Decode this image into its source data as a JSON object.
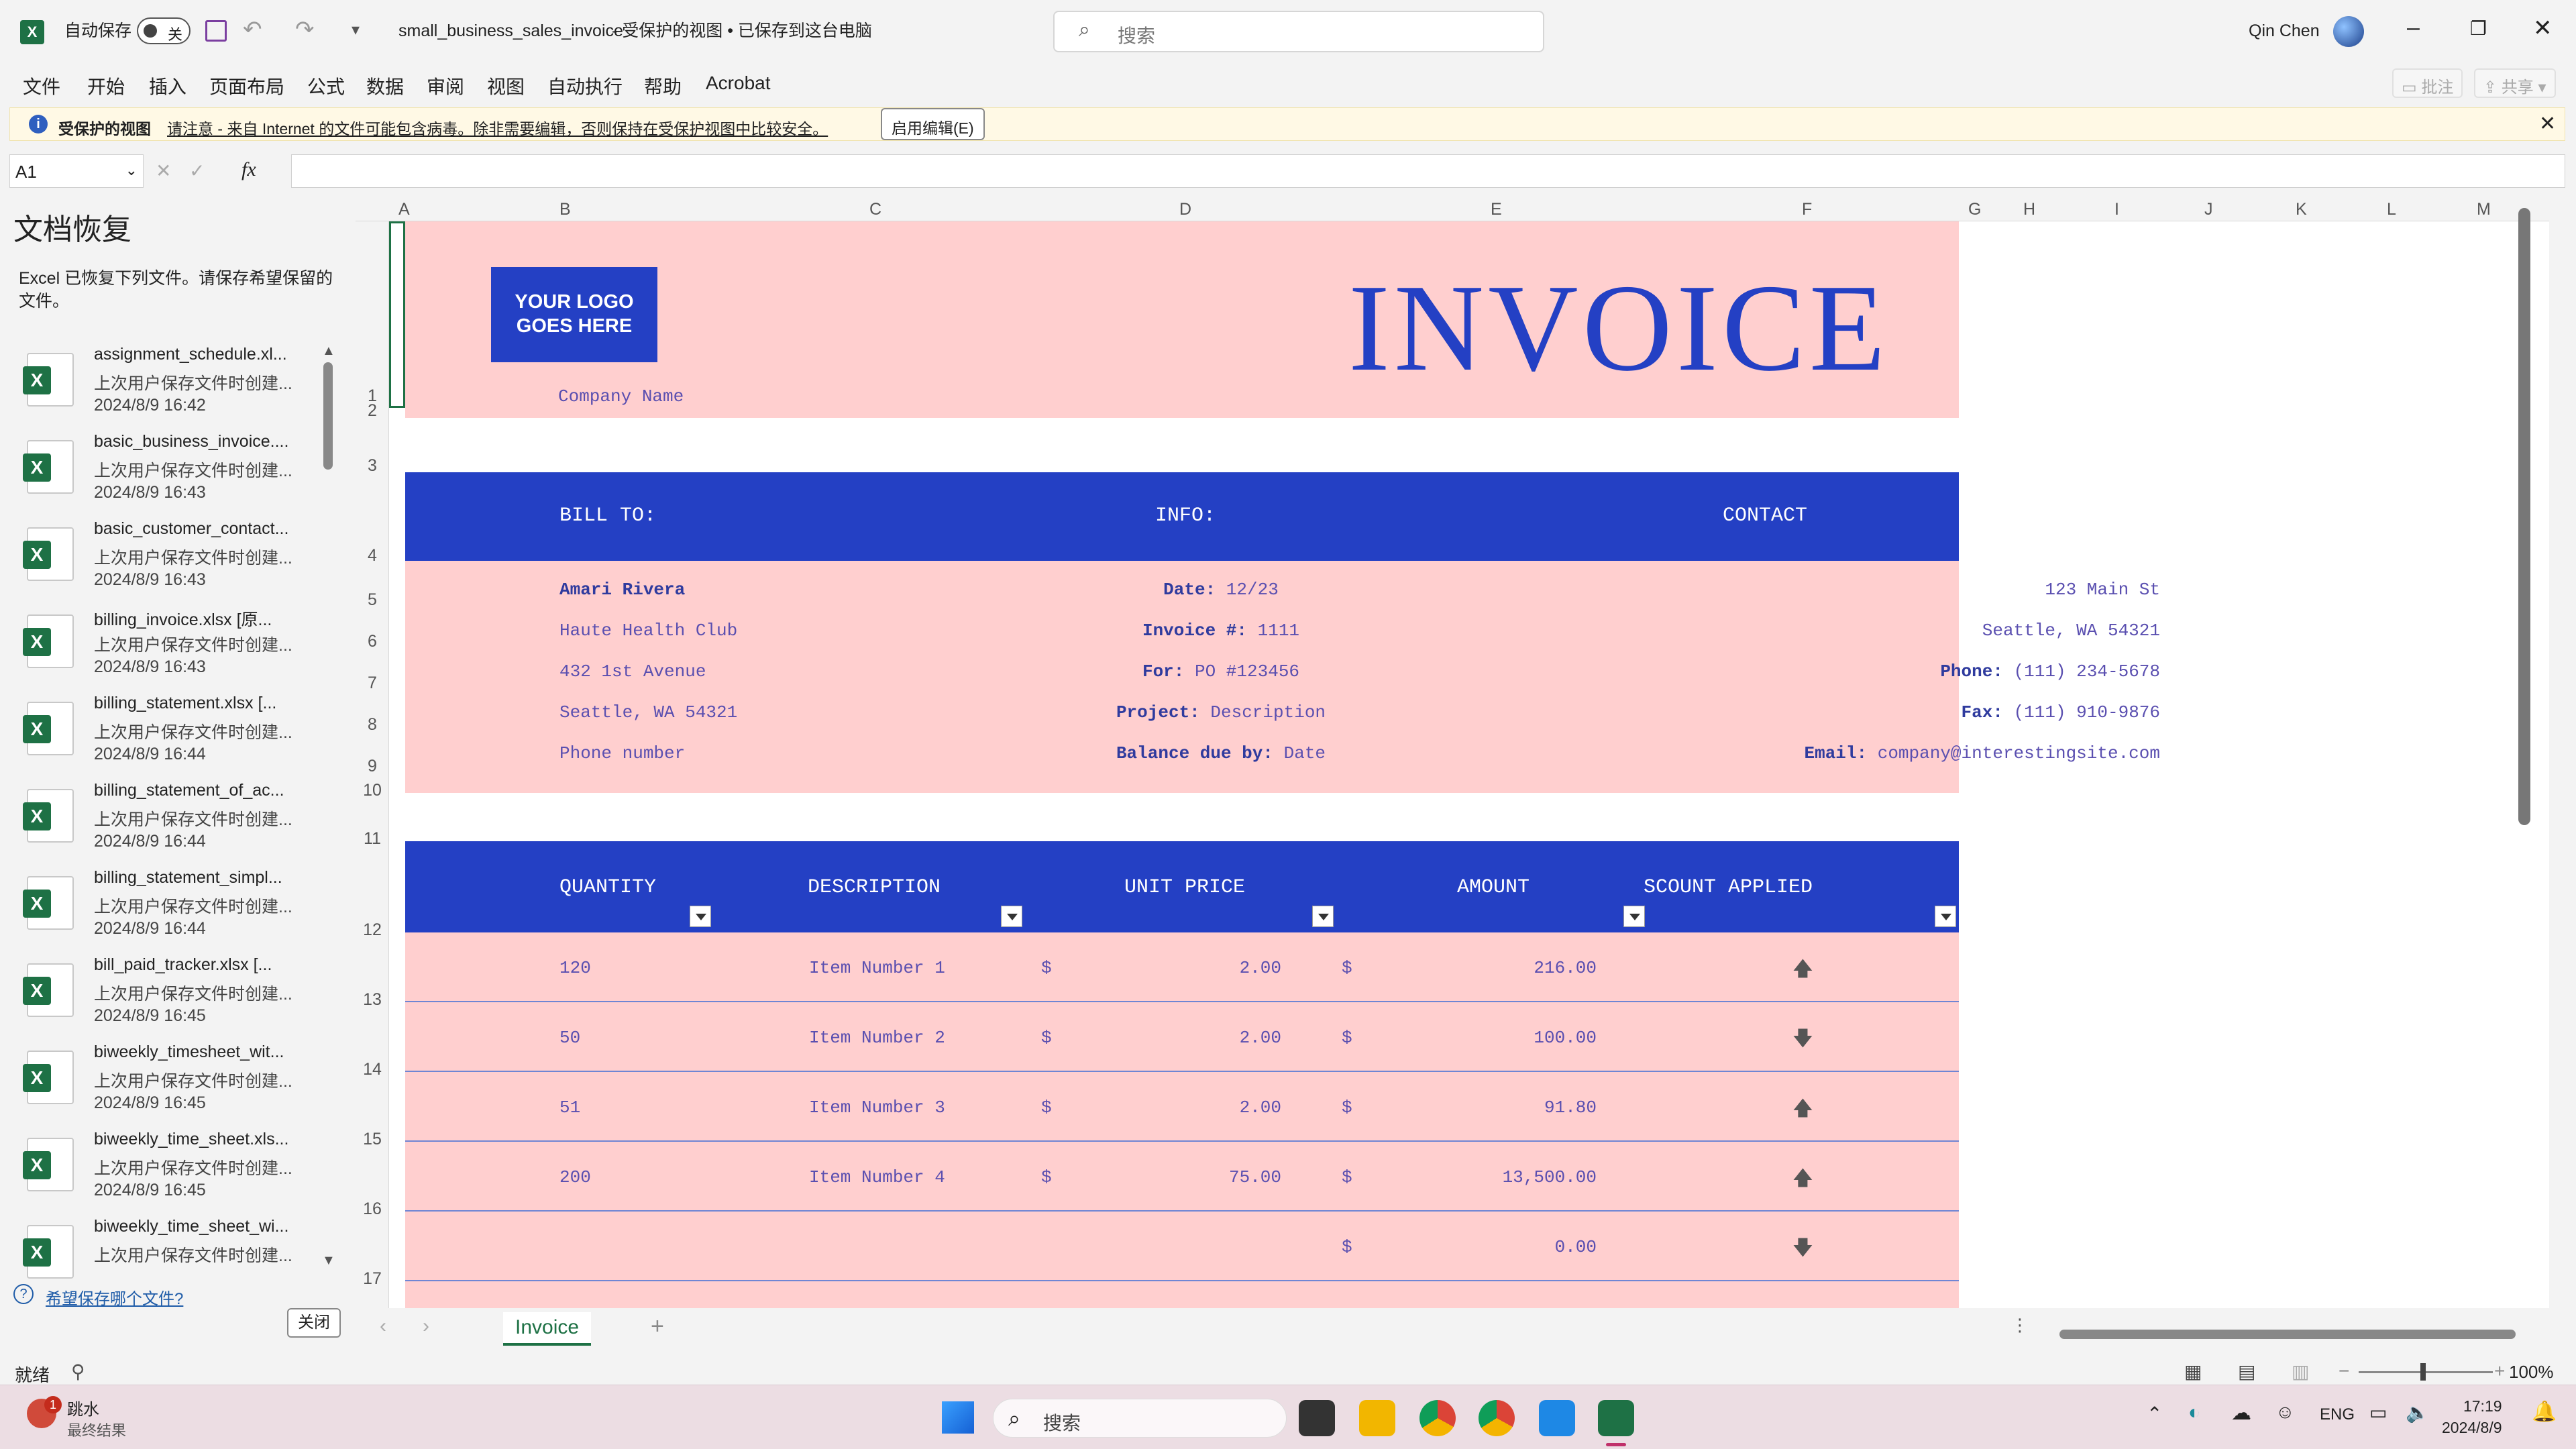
{
  "titlebar": {
    "autosave_label": "自动保存",
    "autosave_state": "关",
    "filename": "small_business_sales_invoice",
    "status": " -  受保护的视图 • 已保存到这台电脑",
    "search_placeholder": "搜索",
    "user": "Qin Chen"
  },
  "menu": [
    "文件",
    "开始",
    "插入",
    "页面布局",
    "公式",
    "数据",
    "审阅",
    "视图",
    "自动执行",
    "帮助",
    "Acrobat"
  ],
  "menu_right": {
    "comments": "批注",
    "share": "共享"
  },
  "protected_bar": {
    "title": "受保护的视图",
    "message": "请注意 - 来自 Internet 的文件可能包含病毒。除非需要编辑，否则保持在受保护视图中比较安全。",
    "button": "启用编辑(E)"
  },
  "formula": {
    "namebox": "A1",
    "fx": "fx",
    "content": ""
  },
  "recovery": {
    "title": "文档恢复",
    "description": "Excel 已恢复下列文件。请保存希望保留的文件。",
    "items": [
      {
        "name": "assignment_schedule.xl...",
        "sub": "上次用户保存文件时创建...",
        "time": "2024/8/9 16:42"
      },
      {
        "name": "basic_business_invoice....",
        "sub": "上次用户保存文件时创建...",
        "time": "2024/8/9 16:43"
      },
      {
        "name": "basic_customer_contact...",
        "sub": "上次用户保存文件时创建...",
        "time": "2024/8/9 16:43"
      },
      {
        "name": "billing_invoice.xlsx  [原...",
        "sub": "上次用户保存文件时创建...",
        "time": "2024/8/9 16:43"
      },
      {
        "name": "billing_statement.xlsx  [...",
        "sub": "上次用户保存文件时创建...",
        "time": "2024/8/9 16:44"
      },
      {
        "name": "billing_statement_of_ac...",
        "sub": "上次用户保存文件时创建...",
        "time": "2024/8/9 16:44"
      },
      {
        "name": "billing_statement_simpl...",
        "sub": "上次用户保存文件时创建...",
        "time": "2024/8/9 16:44"
      },
      {
        "name": "bill_paid_tracker.xlsx  [...",
        "sub": "上次用户保存文件时创建...",
        "time": "2024/8/9 16:45"
      },
      {
        "name": "biweekly_timesheet_wit...",
        "sub": "上次用户保存文件时创建...",
        "time": "2024/8/9 16:45"
      },
      {
        "name": "biweekly_time_sheet.xls...",
        "sub": "上次用户保存文件时创建...",
        "time": "2024/8/9 16:45"
      },
      {
        "name": "biweekly_time_sheet_wi...",
        "sub": "上次用户保存文件时创建...",
        "time": ""
      }
    ],
    "help_link": "希望保存哪个文件?",
    "close_button": "关闭"
  },
  "columns": [
    "A",
    "B",
    "C",
    "D",
    "E",
    "F",
    "G",
    "H",
    "I",
    "J",
    "K",
    "L",
    "M"
  ],
  "rows": [
    "1",
    "2",
    "3",
    "4",
    "5",
    "6",
    "7",
    "8",
    "9",
    "10",
    "11",
    "12",
    "13",
    "14",
    "15",
    "16",
    "17"
  ],
  "invoice": {
    "logo_line1": "YOUR LOGO",
    "logo_line2": "GOES HERE",
    "title": "INVOICE",
    "company": "Company Name",
    "bill_to": "BILL TO:",
    "info": "INFO:",
    "contact": "CONTACT",
    "client": {
      "name": "Amari Rivera",
      "company": "Haute Health Club",
      "address": "432 1st Avenue",
      "city": "Seattle, WA 54321",
      "phone": "Phone number"
    },
    "info_rows": [
      {
        "label": "Date:",
        "value": "12/23"
      },
      {
        "label": "Invoice #:",
        "value": "1111"
      },
      {
        "label": "For:",
        "value": "PO #123456"
      },
      {
        "label": "Project:",
        "value": "Description"
      },
      {
        "label": "Balance due by:",
        "value": "Date"
      }
    ],
    "contact_rows": [
      {
        "label": "",
        "value": "123 Main St"
      },
      {
        "label": "",
        "value": "Seattle, WA 54321"
      },
      {
        "label": "Phone:",
        "value": "(111) 234-5678"
      },
      {
        "label": "Fax:",
        "value": "(111) 910-9876"
      },
      {
        "label": "Email:",
        "value": "company@interestingsite.com"
      }
    ],
    "table_headers": [
      "QUANTITY",
      "DESCRIPTION",
      "UNIT PRICE",
      "AMOUNT",
      "SCOUNT APPLIED"
    ],
    "items": [
      {
        "qty": "120",
        "desc": "Item Number 1",
        "cur1": "$",
        "unit": "2.00",
        "cur2": "$",
        "amount": "216.00",
        "arrow": "🡅"
      },
      {
        "qty": "50",
        "desc": "Item Number 2",
        "cur1": "$",
        "unit": "2.00",
        "cur2": "$",
        "amount": "100.00",
        "arrow": "🡇"
      },
      {
        "qty": "51",
        "desc": "Item Number 3",
        "cur1": "$",
        "unit": "2.00",
        "cur2": "$",
        "amount": "91.80",
        "arrow": "🡅"
      },
      {
        "qty": "200",
        "desc": "Item Number 4",
        "cur1": "$",
        "unit": "75.00",
        "cur2": "$",
        "amount": "13,500.00",
        "arrow": "🡅"
      },
      {
        "qty": "",
        "desc": "",
        "cur1": "",
        "unit": "",
        "cur2": "$",
        "amount": "0.00",
        "arrow": "🡇"
      }
    ]
  },
  "sheet_tab": "Invoice",
  "status": {
    "ready": "就绪",
    "zoom": "100%"
  },
  "taskbar": {
    "weather_title": "跳水",
    "weather_sub": "最终结果",
    "search": "搜索",
    "lang": "ENG",
    "time": "17:19",
    "date": "2024/8/9"
  },
  "colors": {
    "invoice_blue": "#2440c4",
    "invoice_pink": "#ffcfcf",
    "excel_green": "#1e7145"
  }
}
